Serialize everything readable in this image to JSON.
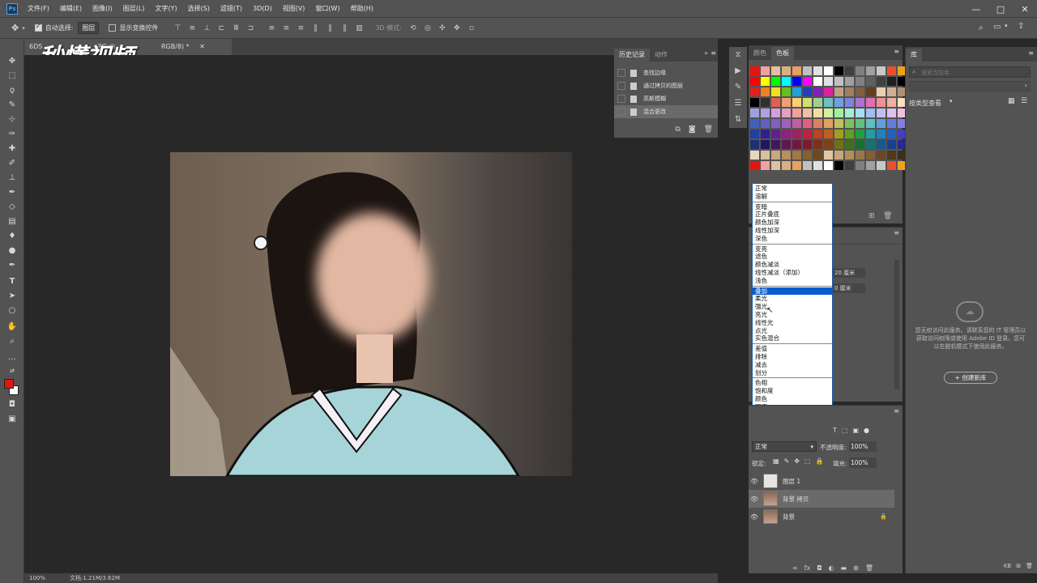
{
  "menubar": {
    "logo": "Ps",
    "items": [
      "文件(F)",
      "编辑(E)",
      "图像(I)",
      "图层(L)",
      "文字(Y)",
      "选择(S)",
      "滤镜(T)",
      "3D(D)",
      "视图(V)",
      "窗口(W)",
      "帮助(H)"
    ],
    "window_controls": [
      "—",
      "□",
      "✕"
    ]
  },
  "options": {
    "auto_select_label": "自动选择:",
    "auto_select_value": "图层",
    "show_transform_label": "显示变换控件",
    "mode_3d_label": "3D 模式:"
  },
  "document": {
    "tab_title": "6DS...JPG @ ...(RGB/8) *",
    "tab_prefix": "6DS",
    "tab_middle": "PG @",
    "tab_suffix": "RGB/8) *",
    "zoom": "100%",
    "doc_info": "文档:1.21M/3.62M"
  },
  "watermark": "秒懂视频",
  "history_panel": {
    "tabs": [
      "历史记录",
      "动作"
    ],
    "items": [
      "查找边缘",
      "通过拷贝的图层",
      "高斯模糊",
      "混合更改"
    ]
  },
  "color_panel": {
    "tabs": [
      "颜色",
      "色板"
    ]
  },
  "properties": {
    "field1": "20 厘米",
    "field2": "0 厘米"
  },
  "blend_modes": {
    "groups": [
      [
        "正常",
        "溶解"
      ],
      [
        "变暗",
        "正片叠底",
        "颜色加深",
        "线性加深",
        "深色"
      ],
      [
        "变亮",
        "滤色",
        "颜色减淡",
        "线性减淡（添加）",
        "浅色"
      ],
      [
        "叠加",
        "柔光",
        "强光",
        "亮光",
        "线性光",
        "点光",
        "实色混合"
      ],
      [
        "差值",
        "排除",
        "减去",
        "划分"
      ],
      [
        "色相",
        "饱和度",
        "颜色",
        "明度"
      ]
    ],
    "selected": "叠加"
  },
  "layers_panel": {
    "blend_value": "正常",
    "opacity_label": "不透明度:",
    "opacity_value": "100%",
    "lock_label": "锁定:",
    "fill_label": "填充:",
    "fill_value": "100%",
    "layers": [
      {
        "name": "图层 1",
        "locked": false,
        "selected": false
      },
      {
        "name": "背景 拷贝",
        "locked": false,
        "selected": true
      },
      {
        "name": "背景",
        "locked": true,
        "selected": false
      }
    ]
  },
  "library_panel": {
    "tab": "库",
    "search_placeholder": "搜索当前库",
    "view_label": "按类型查看",
    "message": "您无权访问此服务。请联系您的 IT 管理员以获取访问权限或使用 Adobe ID 登录。您可以在脱机模式下使用此服务。",
    "create_button": "+ 创建新库",
    "size_label": "KB"
  },
  "colors": {
    "ui_dark": "#282828",
    "ui_mid": "#535353",
    "selection_blue": "#0a5cd0",
    "foreground": "#e8140c",
    "background": "#ffffff"
  }
}
